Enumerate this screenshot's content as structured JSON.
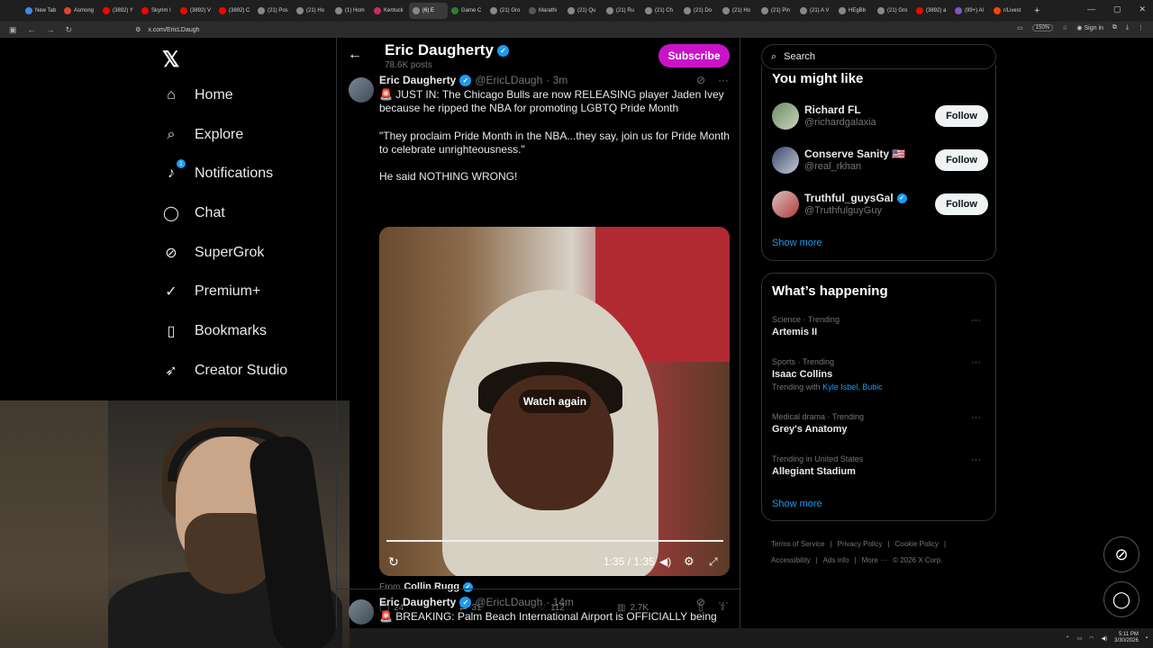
{
  "browser": {
    "tabs": [
      {
        "label": "New Tab",
        "color": "#4285f4"
      },
      {
        "label": "Asmong",
        "color": "#e5432f"
      },
      {
        "label": "(3892) Y",
        "color": "#ff0000"
      },
      {
        "label": "Skyrim I",
        "color": "#ff0000"
      },
      {
        "label": "(3892) V",
        "color": "#ff0000"
      },
      {
        "label": "(3892) C",
        "color": "#ff0000"
      },
      {
        "label": "(21) Pos",
        "color": "#888888"
      },
      {
        "label": "(21) Ho",
        "color": "#888888"
      },
      {
        "label": "(1) Hom",
        "color": "#888888"
      },
      {
        "label": "Kentuck",
        "color": "#cc2b5e"
      },
      {
        "label": "(6) E",
        "color": "#888888"
      },
      {
        "label": "Game C",
        "color": "#2e7d32"
      },
      {
        "label": "(21) Gro",
        "color": "#888888"
      },
      {
        "label": "Marathi",
        "color": "#555555"
      },
      {
        "label": "(21) Qu",
        "color": "#888888"
      },
      {
        "label": "(21) Ru",
        "color": "#888888"
      },
      {
        "label": "(21) Ch",
        "color": "#888888"
      },
      {
        "label": "(21) Do",
        "color": "#888888"
      },
      {
        "label": "(21) Ho",
        "color": "#888888"
      },
      {
        "label": "(21) Pin",
        "color": "#888888"
      },
      {
        "label": "(21) A V",
        "color": "#888888"
      },
      {
        "label": "HEgBb",
        "color": "#888888"
      },
      {
        "label": "(21) Gro",
        "color": "#888888"
      },
      {
        "label": "(3892) a",
        "color": "#ff0000"
      },
      {
        "label": "(99+) Al",
        "color": "#7e57c2"
      },
      {
        "label": "r/Livest",
        "color": "#ff4500"
      }
    ],
    "url": "x.com/EricLDaugh",
    "zoom": "150%",
    "signin": "Sign in"
  },
  "nav": {
    "items": [
      {
        "label": "Home",
        "icon": "home-icon",
        "glyph": "⌂"
      },
      {
        "label": "Explore",
        "icon": "search-icon",
        "glyph": "⌕"
      },
      {
        "label": "Notifications",
        "icon": "bell-icon",
        "glyph": "♪"
      },
      {
        "label": "Chat",
        "icon": "chat-icon",
        "glyph": "◯"
      },
      {
        "label": "SuperGrok",
        "icon": "grok-icon",
        "glyph": "⊘"
      },
      {
        "label": "Premium+",
        "icon": "premium-icon",
        "glyph": "✓"
      },
      {
        "label": "Bookmarks",
        "icon": "bookmark-icon",
        "glyph": "▯"
      },
      {
        "label": "Creator Studio",
        "icon": "rocket-icon",
        "glyph": "➶"
      }
    ],
    "notif_badge": "1"
  },
  "header": {
    "title": "Eric Daugherty",
    "posts": "78.6K posts",
    "subscribe": "Subscribe"
  },
  "tweet1": {
    "name": "Eric Daugherty",
    "handle": "@EricLDaugh",
    "time": "· 3m",
    "line1": "🚨 JUST IN: The Chicago Bulls are now RELEASING player Jaden Ivey because he ripped the NBA for promoting LGBTQ Pride Month",
    "line2": "\"They proclaim Pride Month in the NBA...they say, join us for Pride Month to celebrate unrighteousness.\"",
    "line3": "He said NOTHING WRONG!",
    "watch_again": "Watch again",
    "video_time": "1:35 / 1:35",
    "from_prefix": "From",
    "from_name": "Collin Rugg",
    "replies": "24",
    "reposts": "31",
    "likes": "112",
    "views": "2.7K"
  },
  "tweet2": {
    "name": "Eric Daugherty",
    "handle": "@EricLDaugh",
    "time": "· 14m",
    "line1": "🚨 BREAKING: Palm Beach International Airport is OFFICIALLY being"
  },
  "search": {
    "placeholder": "Search"
  },
  "might_like": {
    "title": "You might like",
    "users": [
      {
        "name": "Richard FL",
        "handle": "@richardgalaxia",
        "follow": "Follow"
      },
      {
        "name": "Conserve Sanity 🇺🇸",
        "handle": "@real_rkhan",
        "follow": "Follow"
      },
      {
        "name": "Truthful_guysGal",
        "handle": "@TruthfulguyGuy",
        "follow": "Follow"
      }
    ],
    "show_more": "Show more"
  },
  "happening": {
    "title": "What’s happening",
    "trends": [
      {
        "context": "Science · Trending",
        "topic": "Artemis II"
      },
      {
        "context": "Sports · Trending",
        "topic": "Isaac Collins",
        "with_prefix": "Trending with",
        "with_names": "Kyle Isbel, Bubic"
      },
      {
        "context": "Medical drama · Trending",
        "topic": "Grey's Anatomy"
      },
      {
        "context": "Trending in United States",
        "topic": "Allegiant Stadium"
      }
    ],
    "show_more": "Show more"
  },
  "footer": {
    "links": [
      "Terms of Service",
      "|",
      "Privacy Policy",
      "|",
      "Cookie Policy",
      "|",
      "Accessibility",
      "|",
      "Ads info",
      "|",
      "More ···",
      "© 2026 X Corp."
    ]
  },
  "taskbar": {
    "time": "5:11 PM",
    "date": "3/30/2026"
  }
}
